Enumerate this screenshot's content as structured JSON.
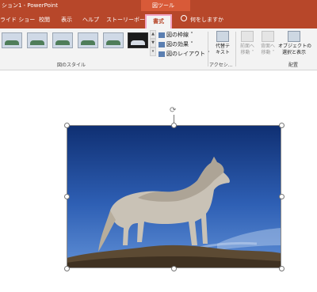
{
  "titlebar": {
    "title": "ション1 - PowerPoint",
    "context_tab_group": "図ツール"
  },
  "tabs": [
    {
      "label": "ライド ショー"
    },
    {
      "label": "校閲"
    },
    {
      "label": "表示"
    },
    {
      "label": "ヘルプ"
    },
    {
      "label": "ストーリーボード"
    },
    {
      "label": "書式",
      "active": true
    },
    {
      "label": "何をしますか"
    }
  ],
  "ribbon": {
    "picture_styles": {
      "group_label": "図のスタイル",
      "style_count": 6
    },
    "picture_commands": {
      "border": "図の枠線 ˅",
      "effects": "図の効果 ˅",
      "layout": "図のレイアウト ˅"
    },
    "accessibility": {
      "alt_text": "代替テ\nキスト",
      "group_label": "アクセシ..."
    },
    "arrange": {
      "bring_forward": "前面へ\n移動 ˅",
      "send_backward": "背面へ\n移動 ˅",
      "selection_pane": "オブジェクトの\n選択と表示",
      "group_label": "配置"
    }
  },
  "slide": {
    "picture": "wolf-on-rock-photo"
  },
  "colors": {
    "accent": "#b7472a",
    "highlight_border": "#f2a3c3",
    "ribbon_bg": "#f3f3f3"
  }
}
